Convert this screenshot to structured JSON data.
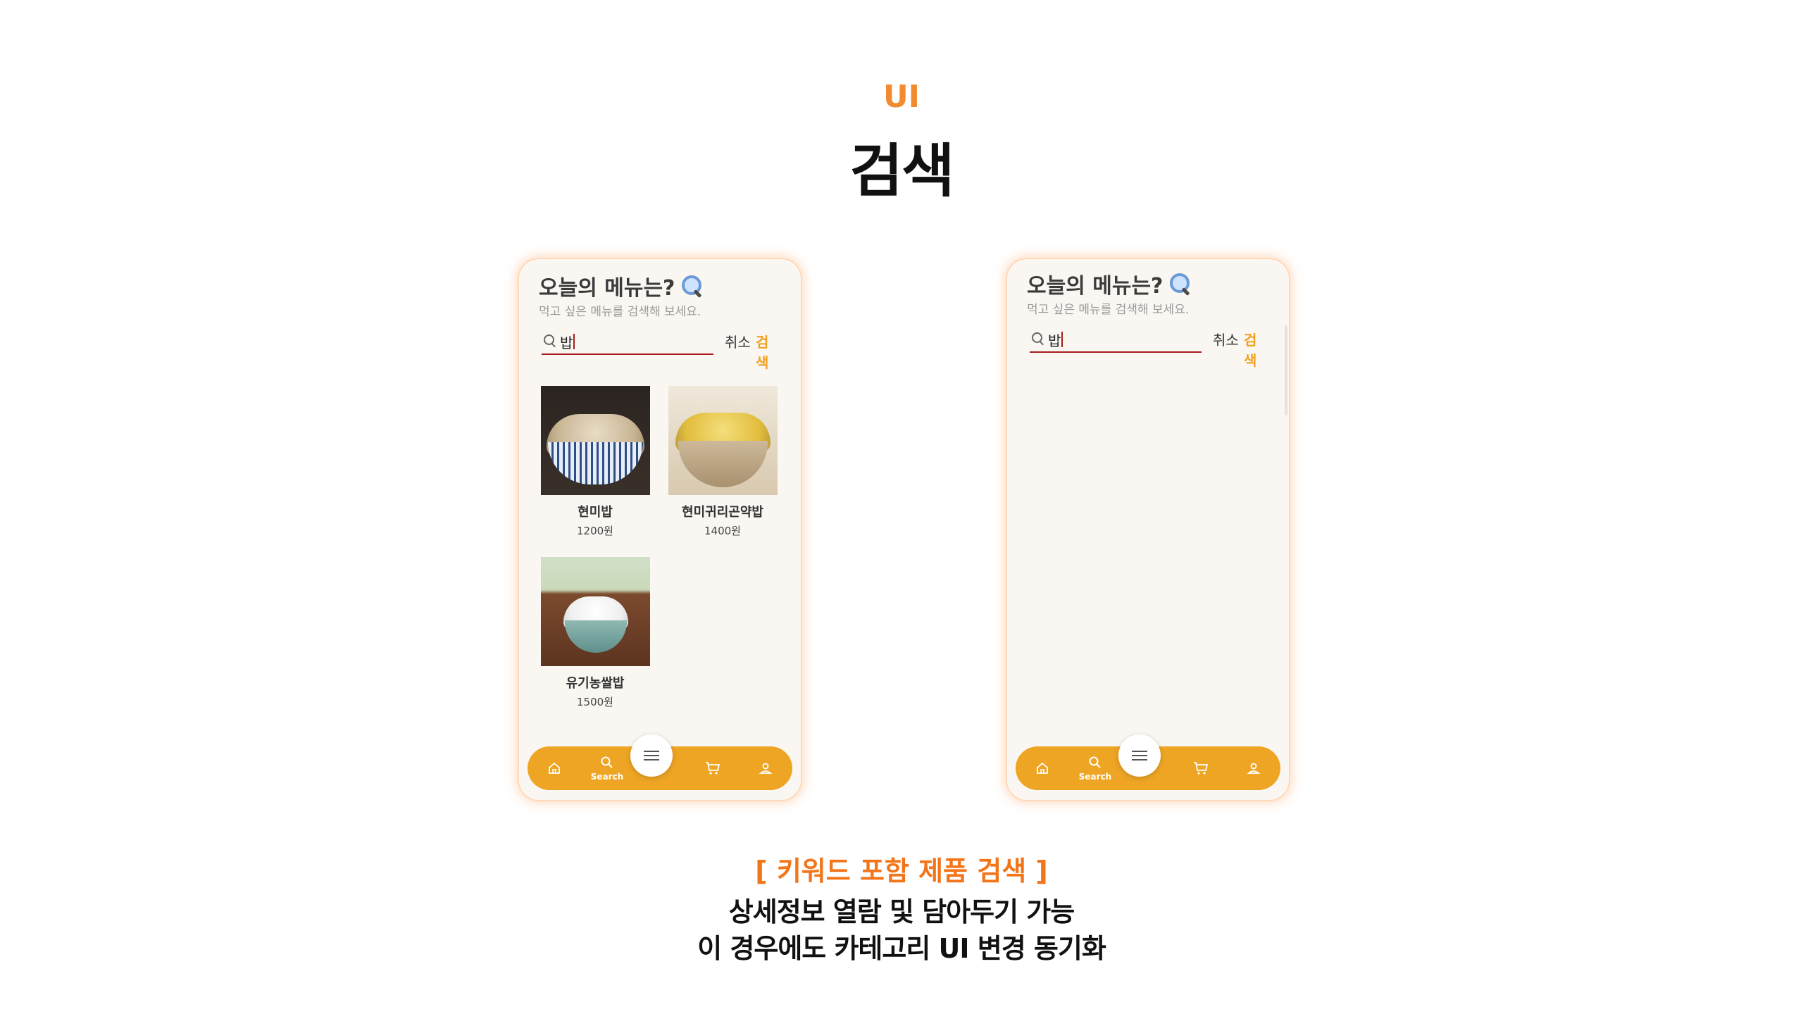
{
  "slide": {
    "kicker": "UI",
    "title": "검색",
    "caption_head": "[ 키워드 포함 제품 검색 ]",
    "caption_lines": [
      "상세정보 열람 및 담아두기 가능",
      "이 경우에도 카테고리 UI 변경 동기화"
    ]
  },
  "screens": [
    {
      "title": "오늘의 메뉴는?",
      "title_icon": "magnifier-emoji-icon",
      "subtitle": "먹고 싶은 메뉴를 검색해 보세요.",
      "search_value": "밥",
      "cancel_label": "취소",
      "search_label": "검색",
      "products": [
        {
          "name": "현미밥",
          "price": "1200원",
          "image": "brown-rice-bowl"
        },
        {
          "name": "현미귀리곤약밥",
          "price": "1400원",
          "image": "oat-konjac-rice-bowl"
        },
        {
          "name": "유기농쌀밥",
          "price": "1500원",
          "image": "white-rice-bowl"
        }
      ]
    },
    {
      "title": "오늘의 메뉴는?",
      "title_icon": "magnifier-emoji-icon",
      "subtitle": "먹고 싶은 메뉴를 검색해 보세요.",
      "search_value": "밥",
      "cancel_label": "취소",
      "search_label": "검색",
      "products": []
    }
  ],
  "tabbar": {
    "items": [
      {
        "icon": "home-icon",
        "label": ""
      },
      {
        "icon": "search-icon",
        "label": "Search"
      },
      {
        "icon": "menu-icon",
        "label": ""
      },
      {
        "icon": "cart-icon",
        "label": ""
      },
      {
        "icon": "user-icon",
        "label": ""
      }
    ],
    "color": "#eea524"
  },
  "colors": {
    "accent": "#f28a2e",
    "search_button": "#f0a020",
    "underline": "#a61c1c"
  }
}
